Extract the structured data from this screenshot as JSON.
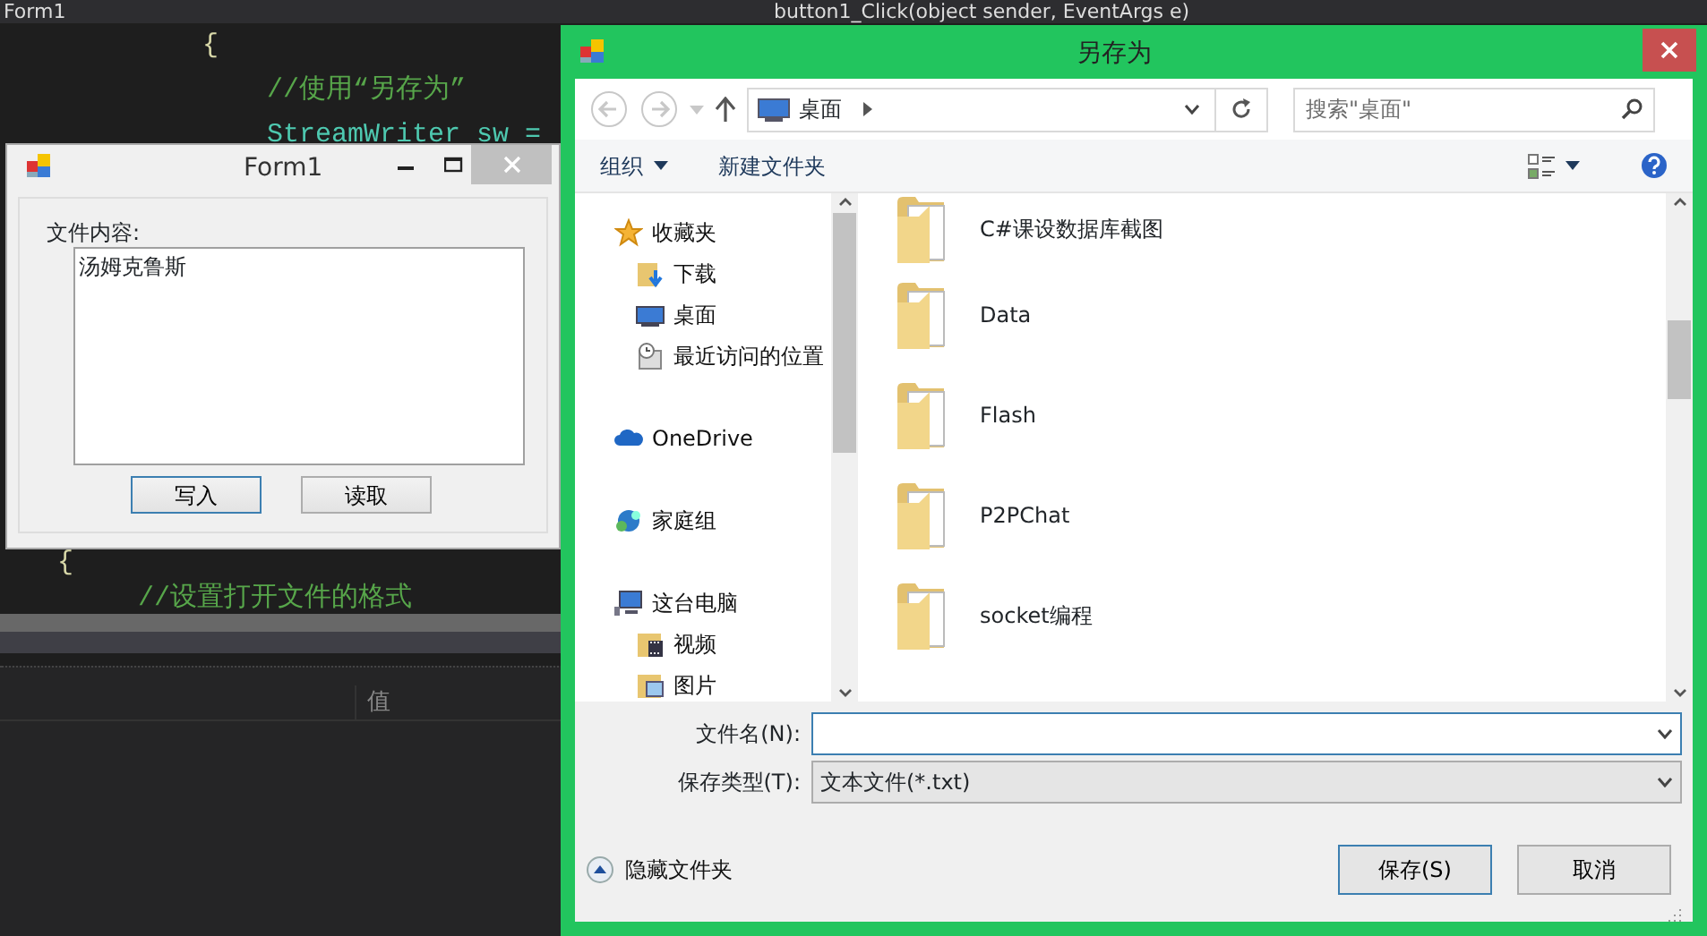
{
  "editor": {
    "tab": "Form1",
    "member": "button1_Click(object sender, EventArgs e)",
    "blocks": [
      {
        "lines": [
          {
            "text": "            {",
            "kind": "brace"
          },
          {
            "text": "                //使用“另存为”",
            "kind": "comment"
          },
          {
            "text": "                StreamWriter sw =",
            "kind": "code"
          }
        ]
      },
      {
        "lines": [
          {
            "text": "   {",
            "kind": "brace"
          },
          {
            "text": "        //设置打开文件的格式",
            "kind": "comment"
          }
        ]
      }
    ]
  },
  "panel": {
    "columns": [
      "值"
    ]
  },
  "form1": {
    "title": "Form1",
    "label": "文件内容:",
    "content": "汤姆克鲁斯",
    "buttons": [
      {
        "label": "写入",
        "focused": true
      },
      {
        "label": "读取",
        "focused": false
      }
    ]
  },
  "dialog": {
    "title": "另存为",
    "address": "桌面",
    "search_placeholder": "搜索\"桌面\"",
    "toolbar": [
      {
        "label": "组织",
        "dropdown": true
      },
      {
        "label": "新建文件夹",
        "dropdown": false
      }
    ],
    "nav": [
      {
        "label": "收藏夹",
        "kind": "favorites",
        "children": [
          {
            "label": "下载",
            "kind": "downloads"
          },
          {
            "label": "桌面",
            "kind": "desktop"
          },
          {
            "label": "最近访问的位置",
            "kind": "recent"
          }
        ]
      },
      {
        "label": "OneDrive",
        "kind": "cloud"
      },
      {
        "label": "家庭组",
        "kind": "homegroup"
      },
      {
        "label": "这台电脑",
        "kind": "computer",
        "children": [
          {
            "label": "视频",
            "kind": "videos"
          },
          {
            "label": "图片",
            "kind": "pictures"
          }
        ]
      }
    ],
    "files": [
      {
        "name": "C#课设数据库截图"
      },
      {
        "name": "Data"
      },
      {
        "name": "Flash"
      },
      {
        "name": "P2PChat"
      },
      {
        "name": "socket编程"
      }
    ],
    "file_name_label": "文件名(N):",
    "file_name_focused": true,
    "save_type": {
      "label": "保存类型(T):",
      "value": "文本文件(*.txt)"
    },
    "hide_folders": "隐藏文件夹",
    "buttons": [
      {
        "label": "保存(S)",
        "default": true
      },
      {
        "label": "取消",
        "default": false
      }
    ]
  }
}
